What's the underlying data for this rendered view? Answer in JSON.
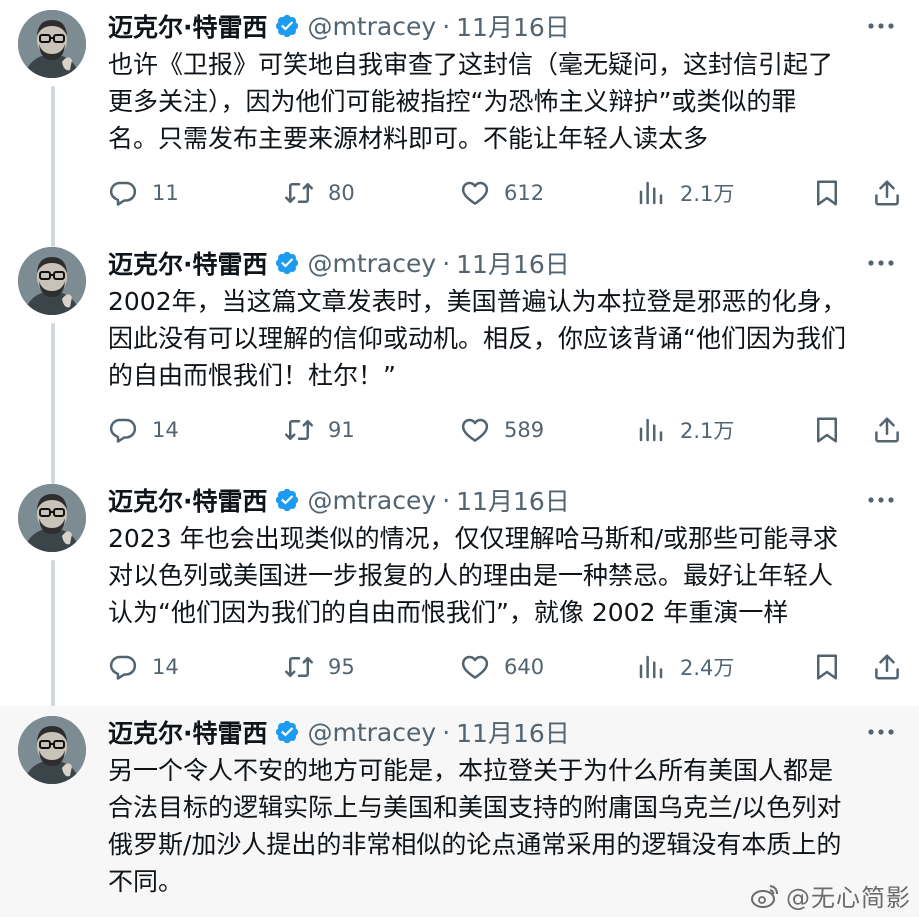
{
  "author": {
    "name": "迈克尔·特雷西",
    "handle": "@mtracey",
    "separator": "·"
  },
  "tweets": [
    {
      "date": "11月16日",
      "lines": [
        "也许《卫报》可笑地自我审查了这封信（毫无疑问，这封信引起了",
        "更多关注），因为他们可能被指控“为恐怖主义辩护”或类似的罪",
        "名。只需发布主要来源材料即可。不能让年轻人读太多"
      ],
      "replies": "11",
      "retweets": "80",
      "likes": "612",
      "views": "2.1万"
    },
    {
      "date": "11月16日",
      "lines": [
        "2002年，当这篇文章发表时，美国普遍认为本拉登是邪恶的化身，",
        "因此没有可以理解的信仰或动机。相反，你应该背诵“他们因为我们",
        "的自由而恨我们！杜尔！”"
      ],
      "replies": "14",
      "retweets": "91",
      "likes": "589",
      "views": "2.1万"
    },
    {
      "date": "11月16日",
      "lines": [
        "2023 年也会出现类似的情况，仅仅理解哈马斯和/或那些可能寻求",
        "对以色列或美国进一步报复的人的理由是一种禁忌。最好让年轻人",
        "认为“他们因为我们的自由而恨我们”，就像 2002 年重演一样"
      ],
      "replies": "14",
      "retweets": "95",
      "likes": "640",
      "views": "2.4万"
    },
    {
      "date": "11月16日",
      "lines": [
        "另一个令人不安的地方可能是，本拉登关于为什么所有美国人都是",
        "合法目标的逻辑实际上与美国和美国支持的附庸国乌克兰/以色列对",
        "俄罗斯/加沙人提出的非常相似的论点通常采用的逻辑没有本质上的",
        "不同。"
      ]
    }
  ],
  "watermark": "@无心简影",
  "colors": {
    "text": "#0f1419",
    "secondary": "#536471",
    "verified": "#1d9bf0",
    "thread_line": "#cfd9de",
    "highlight_bg": "#f7f7f7"
  },
  "icons": [
    "verified-badge-icon",
    "more-icon",
    "reply-icon",
    "retweet-icon",
    "like-icon",
    "views-icon",
    "bookmark-icon",
    "share-icon",
    "weibo-logo-icon"
  ]
}
